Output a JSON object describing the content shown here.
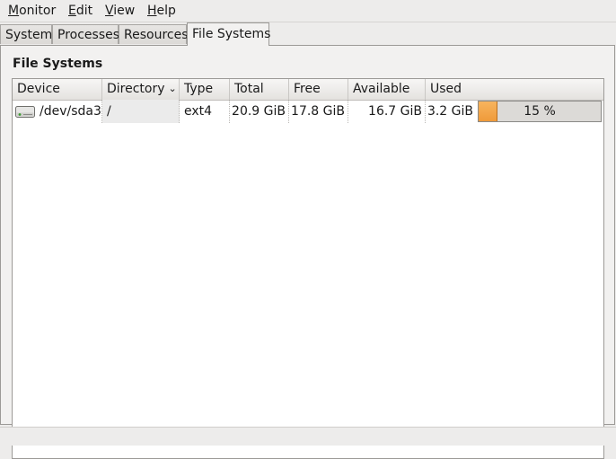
{
  "menubar": {
    "items": [
      {
        "first": "M",
        "rest": "onitor"
      },
      {
        "first": "E",
        "rest": "dit"
      },
      {
        "first": "V",
        "rest": "iew"
      },
      {
        "first": "H",
        "rest": "elp"
      }
    ]
  },
  "tabs": [
    {
      "label": "System"
    },
    {
      "label": "Processes"
    },
    {
      "label": "Resources"
    },
    {
      "label": "File Systems",
      "active": true
    }
  ],
  "panel": {
    "title": "File Systems"
  },
  "table": {
    "columns": [
      "Device",
      "Directory",
      "Type",
      "Total",
      "Free",
      "Available",
      "Used"
    ],
    "sorted_column": "Directory",
    "rows": [
      {
        "icon": "hard-drive-icon",
        "device": "/dev/sda3",
        "directory": "/",
        "type": "ext4",
        "total": "20.9 GiB",
        "free": "17.8 GiB",
        "available": "16.7 GiB",
        "used": "3.2 GiB",
        "used_percent": 15,
        "used_percent_label": "15 %"
      }
    ]
  },
  "colors": {
    "progress_fill": "#ef9a3a",
    "background": "#edeceb"
  }
}
